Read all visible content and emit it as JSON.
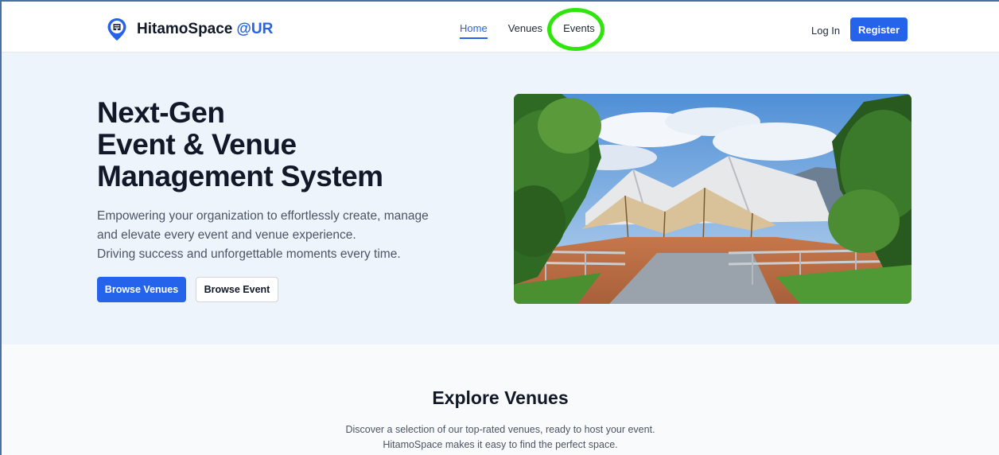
{
  "navbar": {
    "brand_name": "HitamoSpace",
    "brand_accent": "@UR",
    "logo_icon": "building-pin-icon",
    "links": [
      {
        "label": "Home",
        "active": true
      },
      {
        "label": "Venues",
        "active": false
      },
      {
        "label": "Events",
        "active": false
      }
    ],
    "login_label": "Log In",
    "register_label": "Register"
  },
  "hero": {
    "title_lines": [
      "Next-Gen",
      "Event & Venue",
      "Management System"
    ],
    "description_lines": [
      "Empowering your organization to effortlessly create, manage",
      "and elevate every event and venue experience.",
      "Driving success and unforgettable moments every time."
    ],
    "primary_button": "Browse Venues",
    "secondary_button": "Browse Event"
  },
  "explore": {
    "title": "Explore Venues",
    "description_lines": [
      "Discover a selection of our top-rated venues, ready to host your event.",
      "HitamoSpace makes it easy to find the perfect space."
    ]
  },
  "colors": {
    "accent": "#2563eb",
    "hero_background": "#eef4fc",
    "highlight_ring": "#2ee60c"
  }
}
